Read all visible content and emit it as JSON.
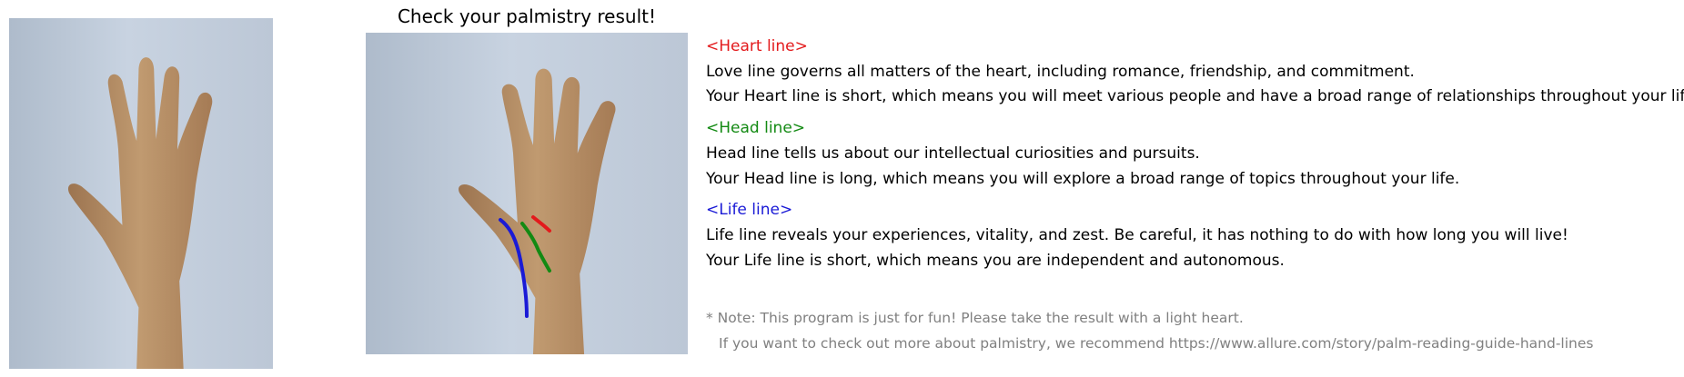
{
  "title": "Check your palmistry result!",
  "sections": [
    {
      "heading": "<Heart line>",
      "color": "#e31a1c",
      "description": "Love line governs all matters of the heart, including romance, friendship, and commitment.",
      "result": "Your Heart line is short, which means you will meet various people and have a broad range of relationships throughout your life."
    },
    {
      "heading": "<Head line>",
      "color": "#138a13",
      "description": "Head line tells us about our intellectual curiosities and pursuits.",
      "result": "Your Head line is long, which means you will explore a broad range of topics throughout your life."
    },
    {
      "heading": "<Life line>",
      "color": "#1a1ad6",
      "description": "Life line reveals your experiences, vitality, and zest. Be careful, it has nothing to do with how long you will live!",
      "result": "Your Life line is short, which means you are independent and autonomous."
    }
  ],
  "note": {
    "line1": "* Note: This program is just for fun! Please take the result with a light heart.",
    "line2": "If you want to check out more about palmistry, we recommend https://www.allure.com/story/palm-reading-guide-hand-lines"
  },
  "colors": {
    "background": "#c3cedd",
    "skin": "#b58c62",
    "note_text": "#808080"
  }
}
